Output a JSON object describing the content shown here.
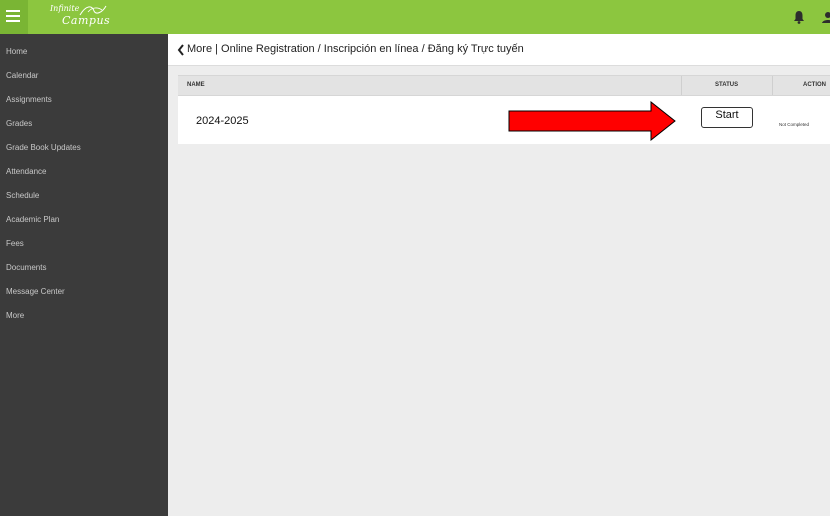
{
  "header": {
    "logo_line1": "Infinite",
    "logo_line2": "Campus",
    "hamburger_icon": "hamburger-menu-icon",
    "bell_icon": "bell-icon",
    "user_icon": "user-icon",
    "accent_color": "#8cc63f"
  },
  "sidebar": {
    "background": "#3b3b3b",
    "items": [
      {
        "label": "Home"
      },
      {
        "label": "Calendar"
      },
      {
        "label": "Assignments"
      },
      {
        "label": "Grades"
      },
      {
        "label": "Grade Book Updates"
      },
      {
        "label": "Attendance"
      },
      {
        "label": "Schedule"
      },
      {
        "label": "Academic Plan"
      },
      {
        "label": "Fees"
      },
      {
        "label": "Documents"
      },
      {
        "label": "Message Center"
      },
      {
        "label": "More"
      }
    ]
  },
  "breadcrumb": {
    "back_icon": "chevron-left-icon",
    "more_label": "More",
    "separator": " | ",
    "title": "Online Registration / Inscripción en línea / Đăng ký Trực tuyến"
  },
  "table": {
    "columns": {
      "name": "NAME",
      "status": "STATUS",
      "action": "ACTION"
    },
    "rows": [
      {
        "name": "2024-2025",
        "start_label": "Start",
        "status": "Not Completed"
      }
    ]
  },
  "annotation": {
    "arrow_icon": "red-arrow-icon",
    "arrow_color": "#ff0000"
  }
}
